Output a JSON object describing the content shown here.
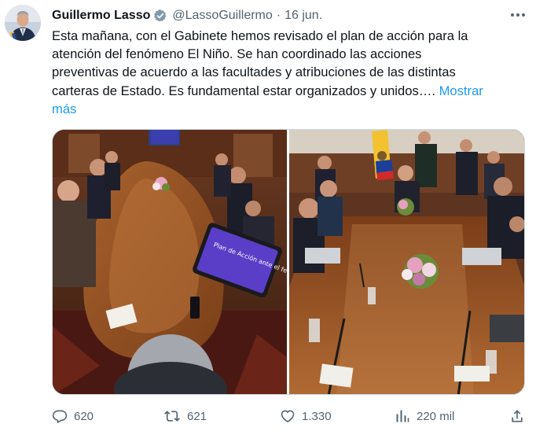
{
  "tweet": {
    "author_name": "Guillermo Lasso",
    "handle": "@LassoGuillermo",
    "separator": "·",
    "date": "16 jun.",
    "text_lines": [
      "Esta mañana, con el Gabinete hemos revisado el plan de acción para la",
      "atención del fenómeno El Niño. Se han coordinado las acciones",
      "preventivas de acuerdo a las facultades y atribuciones de las distintas",
      "carteras de Estado. Es fundamental estar organizados y unidos…."
    ],
    "show_more_part1": "Mostrar",
    "show_more_part2": "más",
    "photo_left_screen_text": "Plan de Acción ante el fenómeno El Niño"
  },
  "actions": {
    "replies": "620",
    "retweets": "621",
    "likes": "1.330",
    "views": "220 mil"
  },
  "icons": {
    "verified": "verified-badge-icon",
    "more": "more-options-icon",
    "reply": "reply-icon",
    "retweet": "retweet-icon",
    "like": "heart-icon",
    "views": "views-chart-icon",
    "share": "share-icon"
  },
  "colors": {
    "text": "#0f1419",
    "secondary": "#536471",
    "link": "#1d9bf0",
    "border": "#cfd9de"
  }
}
